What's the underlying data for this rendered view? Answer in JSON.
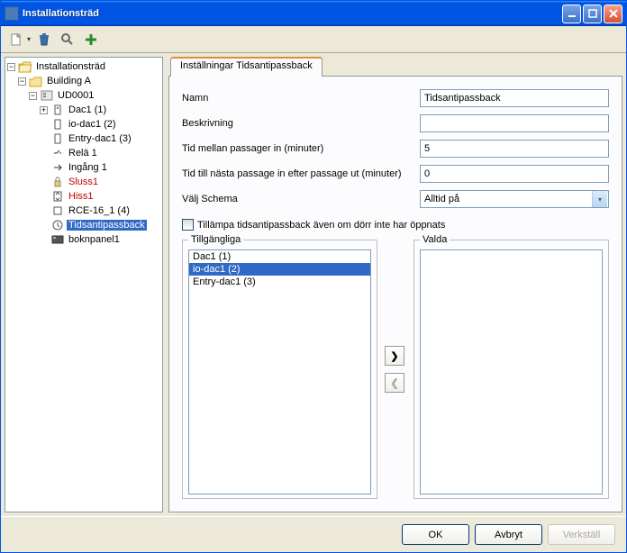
{
  "window": {
    "title": "Installationsträd"
  },
  "tree": {
    "root": "Installationsträd",
    "building": "Building A",
    "ud": "UD0001",
    "nodes": {
      "dac1": "Dac1 (1)",
      "iodac1": "io-dac1 (2)",
      "entrydac1": "Entry-dac1 (3)",
      "rela1": "Relä 1",
      "ingang1": "Ingång 1",
      "sluss1": "Sluss1",
      "hiss1": "Hiss1",
      "rce16": "RCE-16_1 (4)",
      "tidsanti": "Tidsantipassback",
      "boknpanel": "boknpanel1"
    }
  },
  "tab": {
    "label": "Inställningar Tidsantipassback"
  },
  "form": {
    "name_label": "Namn",
    "name_value": "Tidsantipassback",
    "desc_label": "Beskrivning",
    "desc_value": "",
    "time_in_label": "Tid mellan passager in (minuter)",
    "time_in_value": "5",
    "time_out_label": "Tid till nästa passage in efter passage ut (minuter)",
    "time_out_value": "0",
    "schema_label": "Välj Schema",
    "schema_value": "Alltid på",
    "checkbox_label": "Tillämpa tidsantipassback även om dörr inte har öppnats"
  },
  "lists": {
    "available_label": "Tillgängliga",
    "selected_label": "Valda",
    "available": {
      "0": "Dac1 (1)",
      "1": "io-dac1 (2)",
      "2": "Entry-dac1 (3)"
    }
  },
  "buttons": {
    "ok": "OK",
    "cancel": "Avbryt",
    "apply": "Verkställ"
  }
}
